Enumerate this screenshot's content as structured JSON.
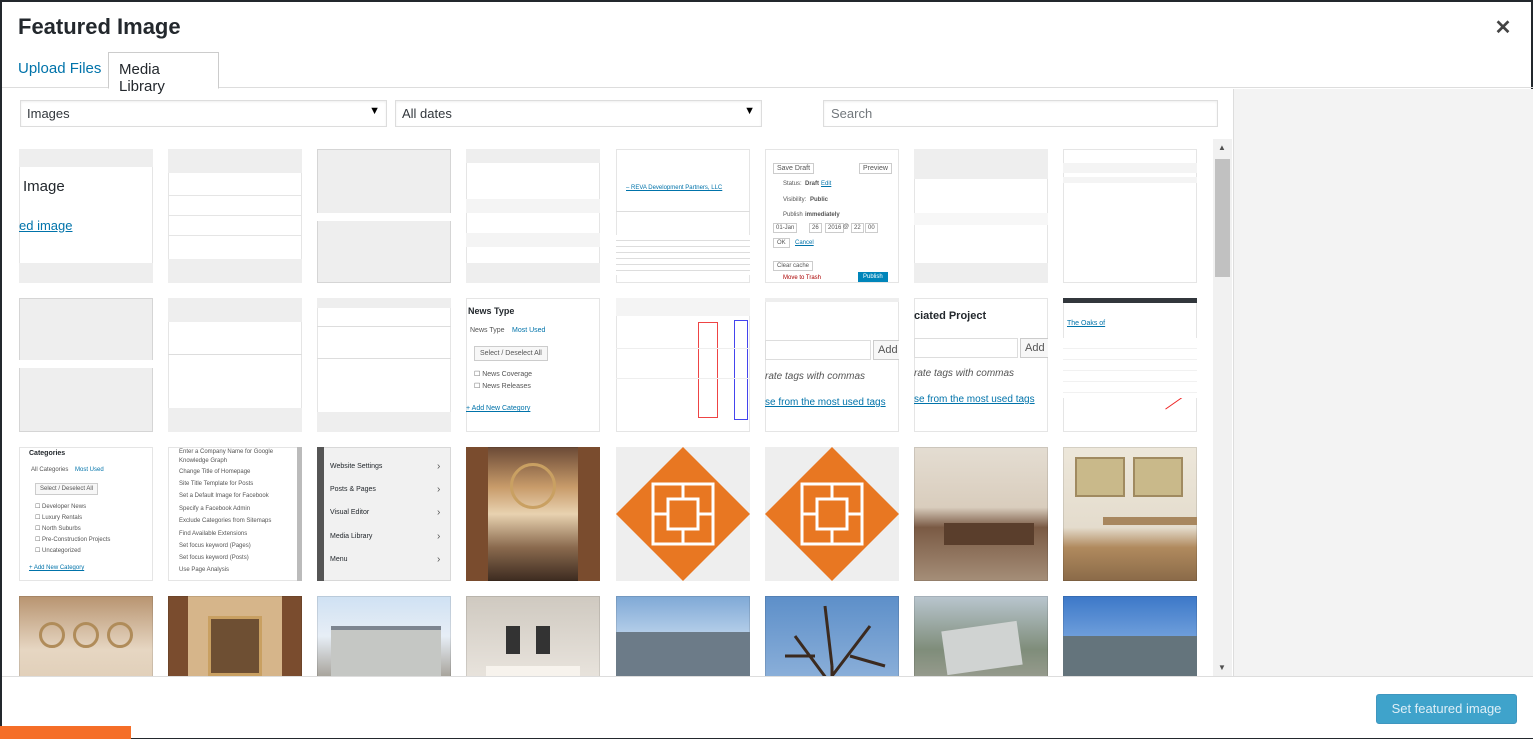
{
  "modal": {
    "title": "Featured Image",
    "close_icon": "close-icon"
  },
  "tabs": [
    {
      "label": "Upload Files",
      "active": false
    },
    {
      "label": "Media Library",
      "active": true
    }
  ],
  "filters": {
    "type_value": "Images",
    "date_value": "All dates",
    "search_placeholder": "Search"
  },
  "thumbs": {
    "t1": {
      "heading": "Image",
      "link": "ed image"
    },
    "t5": {
      "company": "– REVA Development Partners, LLC"
    },
    "t6": {
      "save_draft": "Save Draft",
      "preview": "Preview",
      "status_label": "Status:",
      "status_value": "Draft",
      "edit": "Edit",
      "visibility_label": "Visibility:",
      "visibility_value": "Public",
      "publish_label": "Publish",
      "publish_value": "immediately",
      "month": "01-Jan",
      "day": "26",
      "year": "2016",
      "at": "@",
      "hour": "22",
      "minute": "00",
      "ok": "OK",
      "cancel": "Cancel",
      "clear_cache": "Clear cache",
      "trash": "Move to Trash",
      "publish_btn": "Publish"
    },
    "t10": {
      "tab_title": "News Type",
      "tab_all": "News Type",
      "tab_most": "Most Used",
      "button": "Select / Deselect All",
      "item1": "News Coverage",
      "item2": "News Releases",
      "add": "+ Add New Category"
    },
    "t13": {
      "add": "Add",
      "hint": "rate tags with commas",
      "link": "se from the most used tags"
    },
    "t14": {
      "title": "ciated Project",
      "add": "Add",
      "hint": "rate tags with commas",
      "link": "se from the most used tags"
    },
    "t15": {
      "title": "The Oaks of"
    },
    "t17": {
      "title": "Categories",
      "tab_all": "All Categories",
      "tab_most": "Most Used",
      "button": "Select / Deselect All",
      "items": [
        "Developer News",
        "Luxury Rentals",
        "North Suburbs",
        "Pre-Construction Projects",
        "Uncategorized"
      ],
      "add": "+ Add New Category"
    },
    "t18": {
      "items": [
        "Enter a Company Name for Google",
        "Knowledge Graph",
        "Change Title of Homepage",
        "Site Title Template for Posts",
        "Set a Default Image for Facebook",
        "Specify a Facebook Admin",
        "Exclude Categories from Sitemaps",
        "Find Available Extensions",
        "Set focus keyword (Pages)",
        "Set focus keyword (Posts)",
        "Use Page Analysis"
      ]
    },
    "t19": {
      "items": [
        "Website Settings",
        "Posts & Pages",
        "Visual Editor",
        "Media Library",
        "Menu"
      ]
    }
  },
  "footer": {
    "button_label": "Set featured image"
  },
  "colors": {
    "accent": "#0085ba",
    "link": "#0073aa",
    "logo_orange": "#e87722",
    "admin_orange": "#f56e28"
  }
}
